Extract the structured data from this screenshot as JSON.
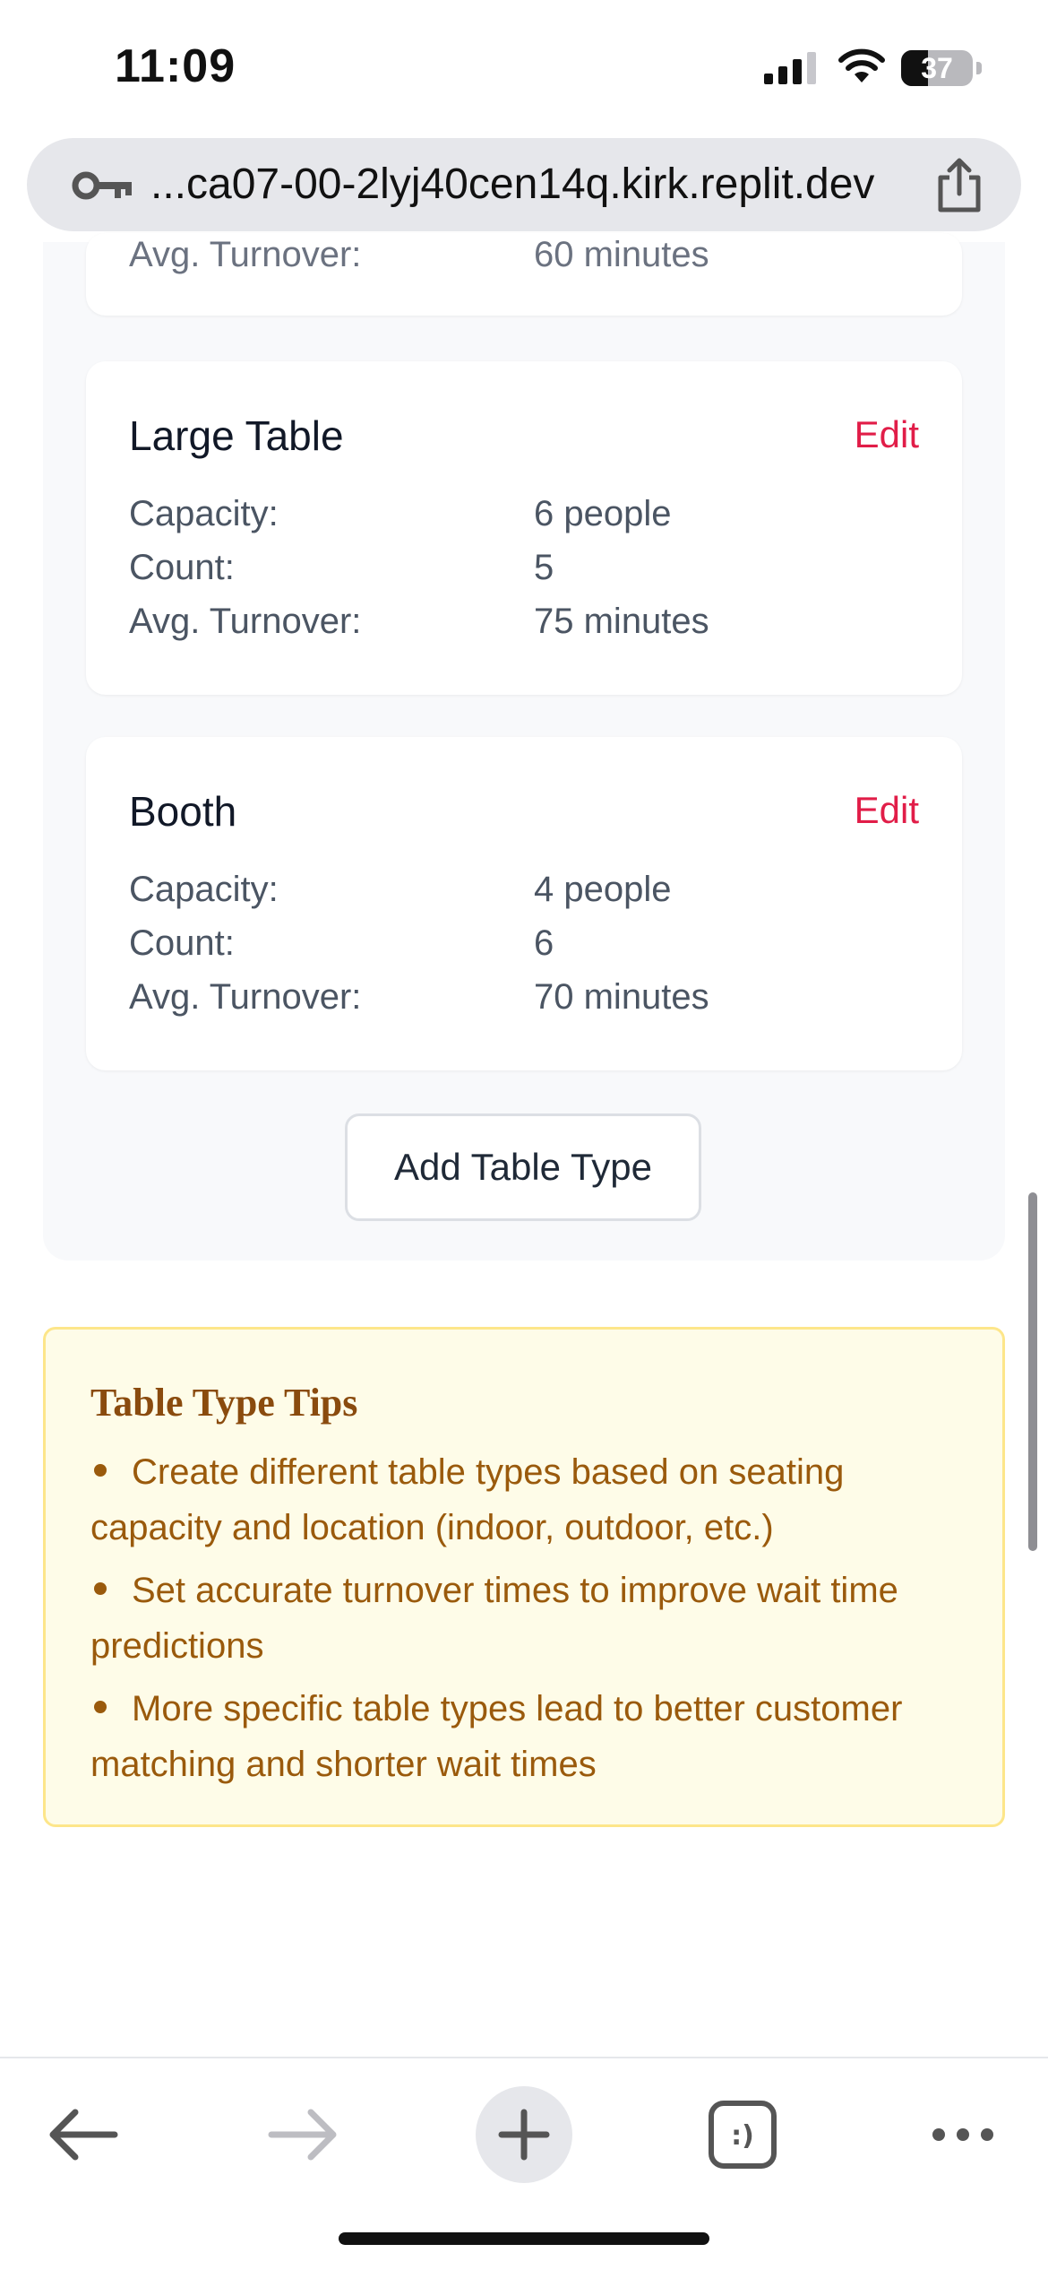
{
  "status_bar": {
    "time": "11:09",
    "battery_percent": "37",
    "battery_level": 0.37
  },
  "browser": {
    "url": "...ca07-00-2lyj40cen14q.kirk.replit.dev"
  },
  "partial_card": {
    "label": "Avg. Turnover:",
    "value": "60 minutes"
  },
  "table_types": [
    {
      "name": "Large Table",
      "edit_label": "Edit",
      "capacity_label": "Capacity:",
      "capacity": "6 people",
      "count_label": "Count:",
      "count": "5",
      "turnover_label": "Avg. Turnover:",
      "turnover": "75 minutes"
    },
    {
      "name": "Booth",
      "edit_label": "Edit",
      "capacity_label": "Capacity:",
      "capacity": "4 people",
      "count_label": "Count:",
      "count": "6",
      "turnover_label": "Avg. Turnover:",
      "turnover": "70 minutes"
    }
  ],
  "add_button_label": "Add Table Type",
  "tips": {
    "title": "Table Type Tips",
    "items": [
      "Create different table types based on seating capacity and location (indoor, outdoor, etc.)",
      "Set accurate turnover times to improve wait time predictions",
      "More specific table types lead to better customer matching and shorter wait times"
    ]
  },
  "colors": {
    "accent": "#e11d48",
    "tips_text": "#9a5a0c",
    "tips_background": "#fefce8",
    "tips_border": "#fde68a"
  },
  "icons": {
    "key": "key-icon",
    "share": "share-icon",
    "back": "back-arrow-icon",
    "forward": "forward-arrow-icon",
    "new_tab": "plus-icon",
    "tabs": "tabs-icon",
    "more": "more-icon"
  }
}
